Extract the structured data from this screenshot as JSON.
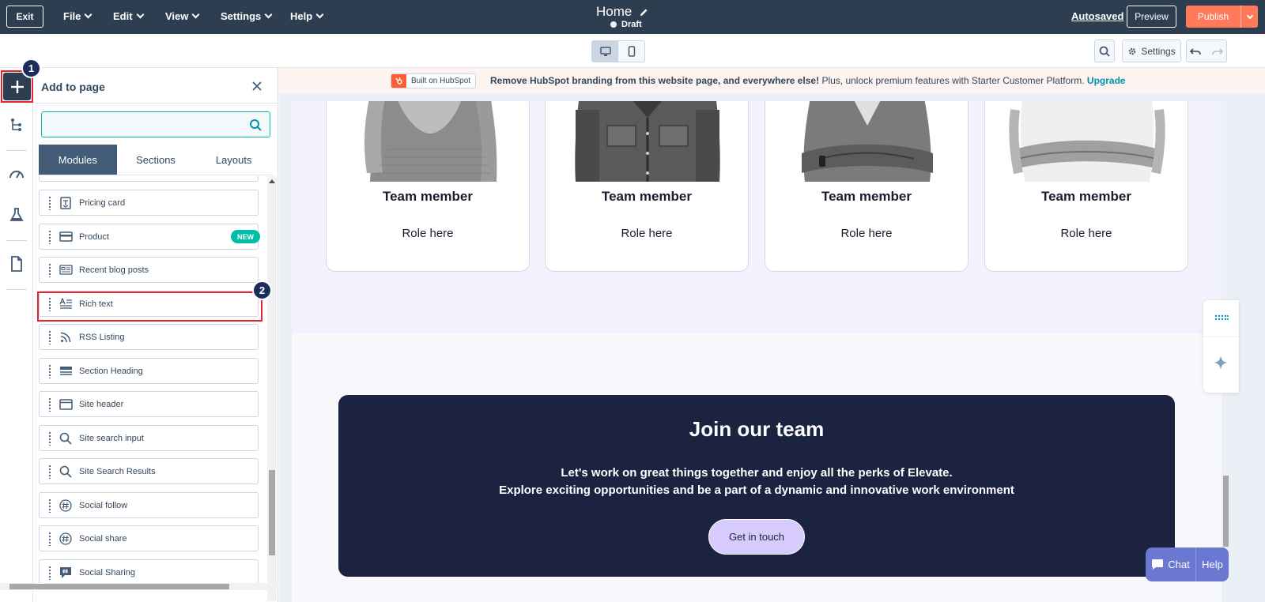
{
  "topbar": {
    "exit_label": "Exit",
    "menus": [
      {
        "label": "File"
      },
      {
        "label": "Edit"
      },
      {
        "label": "View"
      },
      {
        "label": "Settings"
      },
      {
        "label": "Help"
      }
    ],
    "page_title": "Home",
    "status": "Draft",
    "autosaved": "Autosaved",
    "preview_label": "Preview",
    "publish_label": "Publish"
  },
  "toolbar": {
    "settings_label": "Settings"
  },
  "steps": {
    "one": "1",
    "two": "2"
  },
  "panel": {
    "title": "Add to page",
    "search_placeholder": "",
    "tabs": [
      {
        "label": "Modules",
        "active": true
      },
      {
        "label": "Sections",
        "active": false
      },
      {
        "label": "Layouts",
        "active": false
      }
    ],
    "modules": [
      {
        "label": "Pricing card",
        "icon": "pricing-card-icon"
      },
      {
        "label": "Product",
        "icon": "product-icon",
        "badge": "NEW"
      },
      {
        "label": "Recent blog posts",
        "icon": "blog-posts-icon"
      },
      {
        "label": "Rich text",
        "icon": "rich-text-icon"
      },
      {
        "label": "RSS Listing",
        "icon": "rss-icon"
      },
      {
        "label": "Section Heading",
        "icon": "section-heading-icon"
      },
      {
        "label": "Site header",
        "icon": "site-header-icon"
      },
      {
        "label": "Site search input",
        "icon": "search-icon"
      },
      {
        "label": "Site Search Results",
        "icon": "search-icon"
      },
      {
        "label": "Social follow",
        "icon": "social-icon"
      },
      {
        "label": "Social share",
        "icon": "social-icon"
      },
      {
        "label": "Social Sharing",
        "icon": "social-sharing-icon"
      }
    ]
  },
  "banner": {
    "badge": "Built on HubSpot",
    "bold_text": "Remove HubSpot branding from this website page, and everywhere else!",
    "text": " Plus, unlock premium features with Starter Customer Platform. ",
    "upgrade": "Upgrade"
  },
  "team": {
    "members": [
      {
        "name": "Team member",
        "role": "Role here"
      },
      {
        "name": "Team member",
        "role": "Role here"
      },
      {
        "name": "Team member",
        "role": "Role here"
      },
      {
        "name": "Team member",
        "role": "Role here"
      }
    ]
  },
  "join": {
    "title": "Join our team",
    "line1": "Let's work on great things together and enjoy all the perks of Elevate.",
    "line2": "Explore exciting opportunities and be a part of a dynamic and innovative work environment",
    "button": "Get in touch"
  },
  "chat": {
    "chat_label": "Chat",
    "help_label": "Help"
  },
  "colors": {
    "topbar": "#2d3e50",
    "publish": "#ff7a59",
    "accent_teal": "#00bda5",
    "highlight_red": "#e8222f",
    "join_card": "#1b2340"
  }
}
